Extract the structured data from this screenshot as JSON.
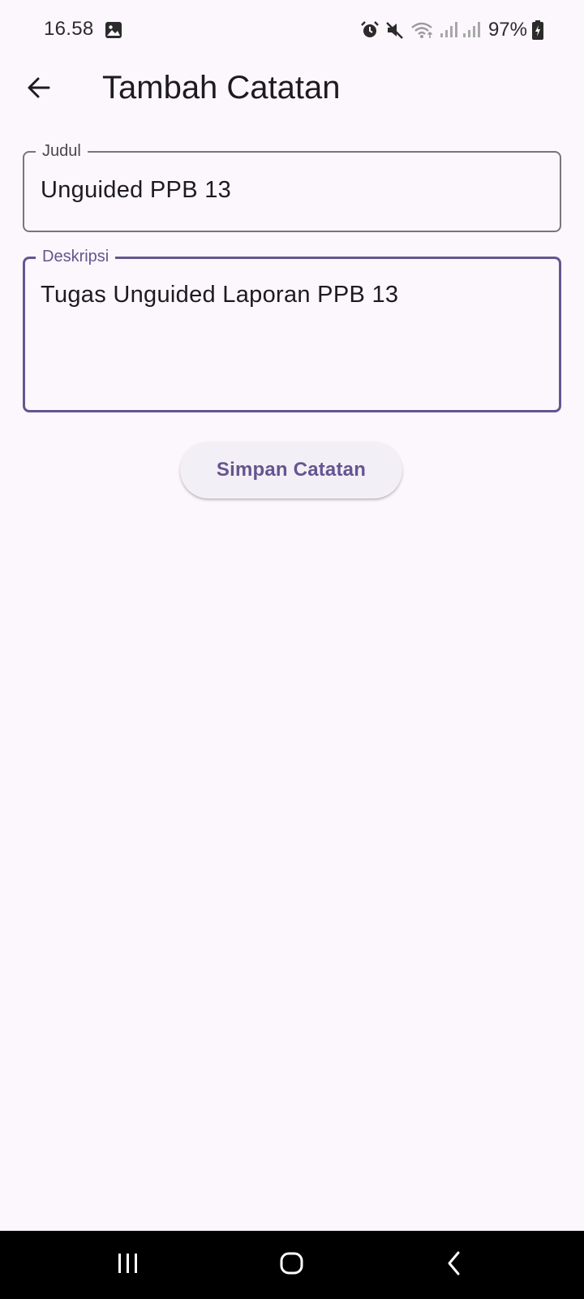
{
  "status_bar": {
    "time": "16.58",
    "battery": "97%",
    "icons": [
      "gallery-icon",
      "alarm-icon",
      "mute-icon",
      "wifi-icon",
      "signal-icon",
      "signal-icon",
      "battery-charging-icon"
    ]
  },
  "app_bar": {
    "title": "Tambah Catatan",
    "back_icon": "arrow-back-icon"
  },
  "form": {
    "judul": {
      "label": "Judul",
      "value": "Unguided PPB 13"
    },
    "deskripsi": {
      "label": "Deskripsi",
      "value": "Tugas Unguided Laporan PPB 13"
    },
    "save_label": "Simpan Catatan"
  },
  "nav_bar": {
    "icons": [
      "recents-icon",
      "home-icon",
      "back-icon"
    ]
  },
  "colors": {
    "background": "#fcf7fc",
    "accent": "#65558f",
    "outline": "#79747e",
    "button_bg": "#f3eff6"
  }
}
